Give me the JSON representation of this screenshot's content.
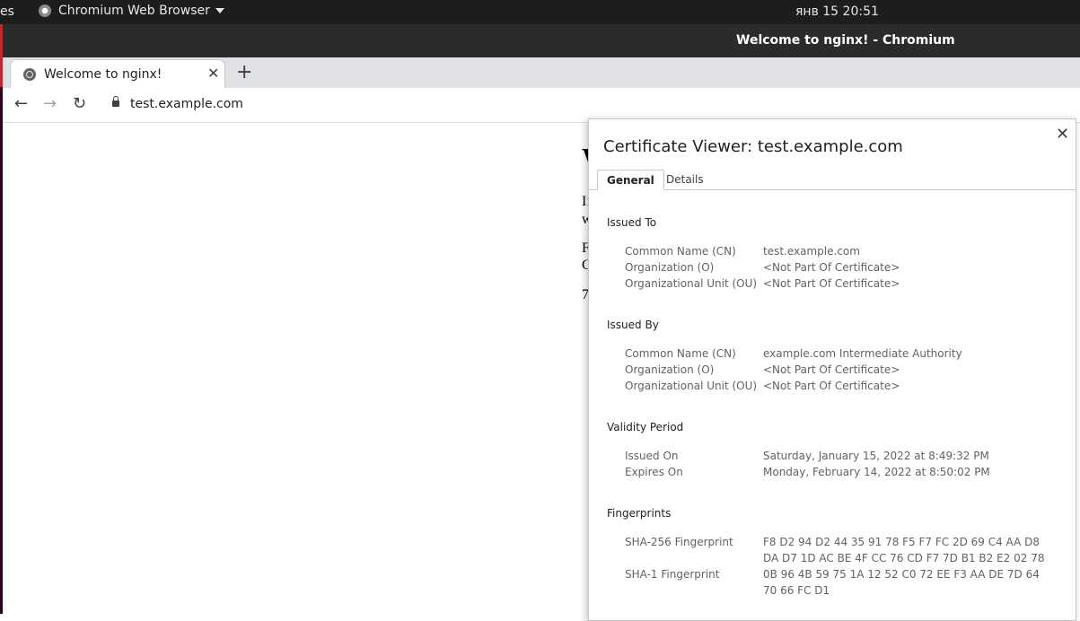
{
  "topbar": {
    "activities_partial": "es",
    "app_name": "Chromium Web Browser",
    "clock": "янв 15  20:51"
  },
  "window": {
    "title": "Welcome to nginx! - Chromium"
  },
  "tabs": [
    {
      "label": "Welcome to nginx!"
    }
  ],
  "toolbar": {
    "url": "test.example.com"
  },
  "page_partial": {
    "heading": "W",
    "line1": "If",
    "line2": "w",
    "line3": "F",
    "line4": "C",
    "line5": "7"
  },
  "dialog": {
    "title": "Certificate Viewer: test.example.com",
    "tabs": {
      "general": "General",
      "details": "Details"
    },
    "issued_to": {
      "heading": "Issued To",
      "cn_label": "Common Name (CN)",
      "cn_value": "test.example.com",
      "o_label": "Organization (O)",
      "o_value": "<Not Part Of Certificate>",
      "ou_label": "Organizational Unit (OU)",
      "ou_value": "<Not Part Of Certificate>"
    },
    "issued_by": {
      "heading": "Issued By",
      "cn_label": "Common Name (CN)",
      "cn_value": "example.com Intermediate Authority",
      "o_label": "Organization (O)",
      "o_value": "<Not Part Of Certificate>",
      "ou_label": "Organizational Unit (OU)",
      "ou_value": "<Not Part Of Certificate>"
    },
    "validity": {
      "heading": "Validity Period",
      "issued_label": "Issued On",
      "issued_value": "Saturday, January 15, 2022 at 8:49:32 PM",
      "expires_label": "Expires On",
      "expires_value": "Monday, February 14, 2022 at 8:50:02 PM"
    },
    "fingerprints": {
      "heading": "Fingerprints",
      "sha256_label": "SHA-256 Fingerprint",
      "sha256_line1": "F8 D2 94 D2 44 35 91 78 F5 F7 FC 2D 69 C4 AA D8",
      "sha256_line2": "DA D7 1D AC BE 4F CC 76 CD F7 7D B1 B2 E2 02 78",
      "sha1_label": "SHA-1 Fingerprint",
      "sha1_line1": "0B 96 4B 59 75 1A 12 52 C0 72 EE F3 AA DE 7D 64",
      "sha1_line2": "70 66 FC D1"
    }
  }
}
